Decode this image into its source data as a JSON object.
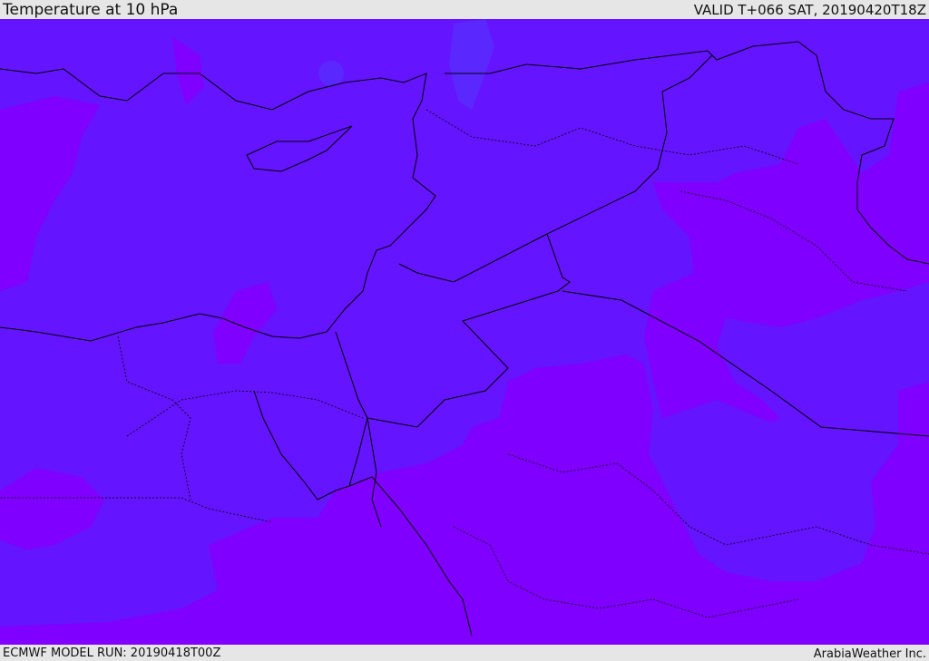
{
  "header": {
    "title": "Temperature at 10 hPa",
    "valid": "VALID T+066 SAT, 20190420T18Z"
  },
  "footer": {
    "model_run": "ECMWF MODEL RUN: 20190418T00Z",
    "credit": "ArabiaWeather Inc."
  },
  "colors": {
    "band_cool": "#6414ff",
    "band_warm": "#8000ff",
    "band_coldest": "#5a28ff",
    "border": "#000000"
  }
}
